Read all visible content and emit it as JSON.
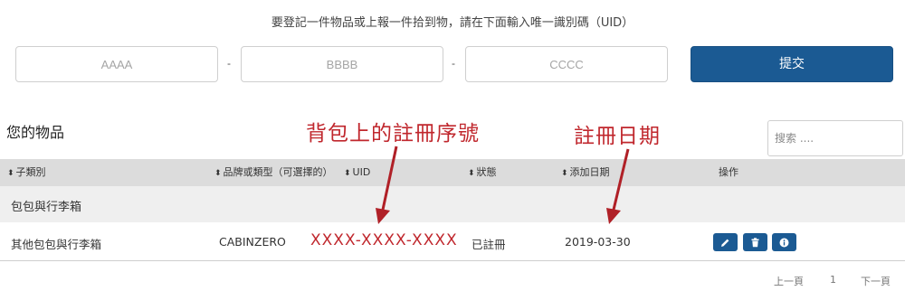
{
  "instruction": "要登記一件物品或上報一件拾到物，請在下面輸入唯一識別碼（UID）",
  "uid_inputs": {
    "part1_placeholder": "AAAA",
    "part2_placeholder": "BBBB",
    "part3_placeholder": "CCCC",
    "separator": "-"
  },
  "submit_label": "提交",
  "section_title": "您的物品",
  "search_placeholder": "搜索 ....",
  "annotations": {
    "uid_note": "背包上的註冊序號",
    "date_note": "註冊日期",
    "color": "#c0272d"
  },
  "table": {
    "sort_icon": "sort-updown-icon",
    "columns": [
      "子類別",
      "品牌或類型（可選擇的）",
      "UID",
      "狀態",
      "添加日期",
      "操作"
    ],
    "group_label": "包包與行李箱",
    "rows": [
      {
        "subcategory": "其他包包與行李箱",
        "brand": "CABINZERO",
        "uid": "XXXX-XXXX-XXXX",
        "status": "已註冊",
        "date_added": "2019-03-30",
        "actions": [
          "edit-icon",
          "delete-icon",
          "info-icon"
        ]
      }
    ]
  },
  "pagination": {
    "prev": "上一頁",
    "current": "1",
    "next": "下一頁"
  },
  "colors": {
    "primary": "#1b5a93",
    "annotation_red": "#c0272d",
    "header_bg": "#dcdcdc",
    "group_bg": "#efefef"
  }
}
